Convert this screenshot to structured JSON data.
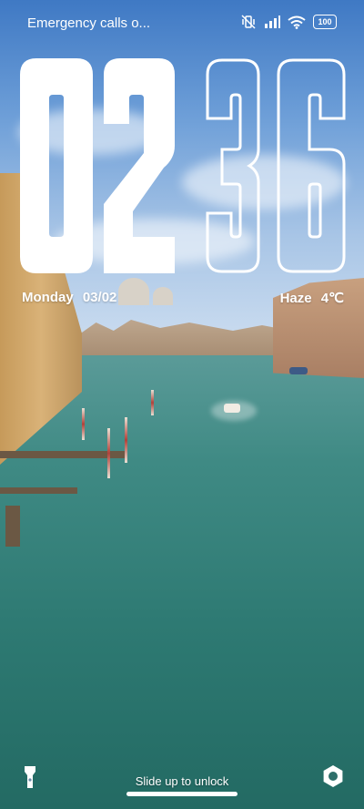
{
  "status_bar": {
    "carrier_text": "Emergency calls o...",
    "battery_level": "100",
    "icons": [
      "vibrate-off-icon",
      "signal-icon",
      "wifi-icon",
      "battery-icon"
    ]
  },
  "clock": {
    "hours": "02",
    "minutes": "36"
  },
  "date": {
    "weekday": "Monday",
    "day_month": "03/02"
  },
  "weather": {
    "condition": "Haze",
    "temperature": "4℃"
  },
  "bottom": {
    "unlock_hint": "Slide up to unlock",
    "left_shortcut_icon": "flashlight-icon",
    "right_shortcut_icon": "camera-icon"
  },
  "colors": {
    "text": "#ffffff",
    "sky": "#6e9fd8",
    "water": "#2e7a73"
  }
}
